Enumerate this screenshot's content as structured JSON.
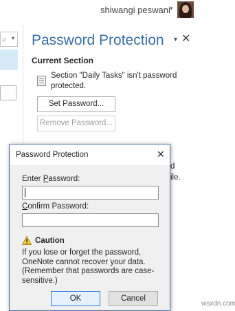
{
  "header": {
    "user_name": "shiwangi peswani",
    "user_caret": "▾",
    "avatar_icon": "user-avatar-icon"
  },
  "left_strip": {
    "search_icon": "⌕",
    "dropdown_icon": "▾"
  },
  "pane": {
    "title": "Password Protection",
    "menu_icon": "▼",
    "close_icon": "✕",
    "section_heading": "Current Section",
    "status_text": "Section \"Daily Tasks\" isn't password protected.",
    "set_password_label": "Set Password...",
    "remove_password_label": "Remove Password...",
    "background_fragments": [
      "d",
      "ile."
    ]
  },
  "dialog": {
    "title": "Password Protection",
    "close_icon": "✕",
    "enter_password_label_prefix": "Enter ",
    "enter_password_label_underlined": "P",
    "enter_password_label_suffix": "assword:",
    "enter_password_value": "",
    "confirm_password_label_underlined": "C",
    "confirm_password_label_suffix": "onfirm Password:",
    "confirm_password_value": "",
    "caution_icon": "warning-icon",
    "caution_label": "Caution",
    "caution_text": "If you lose or forget the password, OneNote cannot recover your data. (Remember that passwords are case-sensitive.)",
    "ok_label": "OK",
    "cancel_label": "Cancel"
  },
  "watermark": "wsxdn.com",
  "colors": {
    "accent_title": "#3a6ea5",
    "dialog_border": "#4a6fa0",
    "ok_focus_border": "#2f7dd6",
    "caution_yellow": "#f2c744"
  }
}
